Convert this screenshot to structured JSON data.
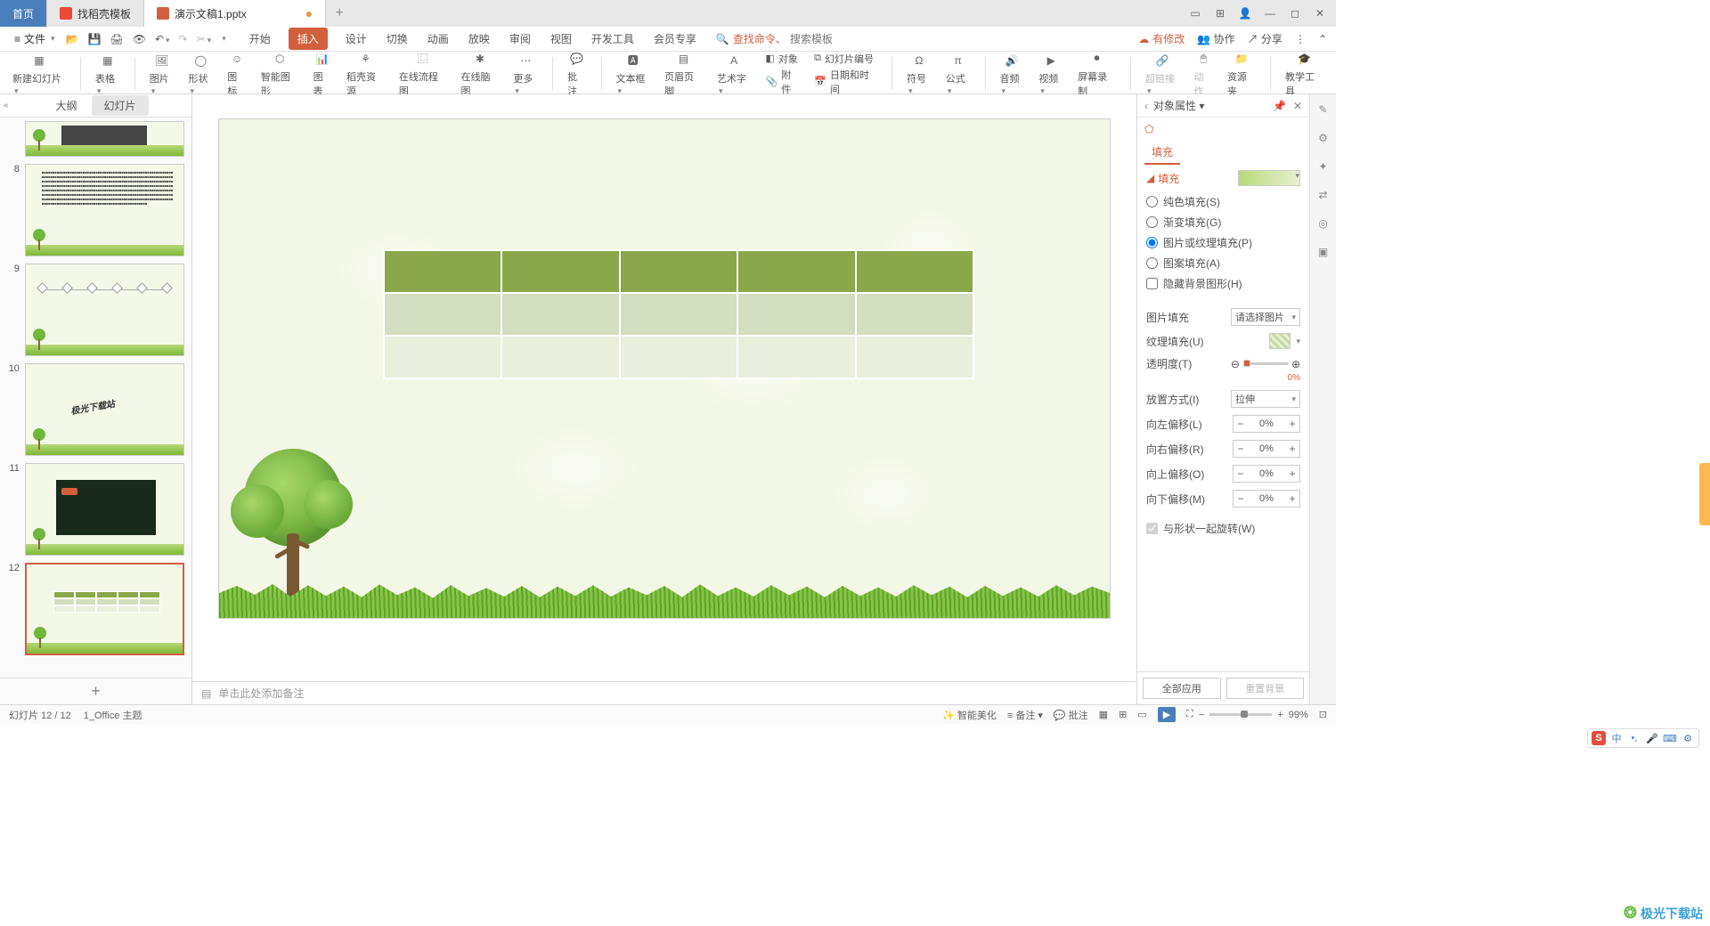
{
  "titlebar": {
    "home": "首页",
    "tab_template": "找稻壳模板",
    "tab_doc": "演示文稿1.pptx"
  },
  "menubar": {
    "file": "文件",
    "items": [
      "开始",
      "插入",
      "设计",
      "切换",
      "动画",
      "放映",
      "审阅",
      "视图",
      "开发工具",
      "会员专享"
    ],
    "active_index": 1,
    "search_prefix": "查找命令、",
    "search_placeholder": "搜索模板",
    "cloud_mod": "有修改",
    "collab": "协作",
    "share": "分享"
  },
  "ribbon": {
    "new_slide": "新建幻灯片",
    "table": "表格",
    "picture": "图片",
    "shape": "形状",
    "icon": "图标",
    "smart_shape": "智能图形",
    "chart": "图表",
    "docer": "稻壳资源",
    "flowchart": "在线流程图",
    "mindmap": "在线脑图",
    "more": "更多",
    "comment": "批注",
    "textbox": "文本框",
    "header_footer": "页眉页脚",
    "wordart": "艺术字",
    "object": "对象",
    "slide_num": "幻灯片编号",
    "attach": "附件",
    "datetime": "日期和时间",
    "symbol": "符号",
    "formula": "公式",
    "audio": "音频",
    "video": "视频",
    "record": "屏幕录制",
    "hyperlink": "超链接",
    "action": "动作",
    "resource": "资源夹",
    "teach": "教学工具"
  },
  "slidepanel": {
    "tab_outline": "大纲",
    "tab_slides": "幻灯片",
    "thumb10_text": "极光下载站"
  },
  "notes_placeholder": "单击此处添加备注",
  "prop": {
    "title": "对象属性",
    "fill_tab": "填充",
    "section_fill": "填充",
    "opt_solid": "纯色填充(S)",
    "opt_gradient": "渐变填充(G)",
    "opt_picture": "图片或纹理填充(P)",
    "opt_pattern": "图案填充(A)",
    "opt_hidebg": "隐藏背景图形(H)",
    "pic_fill": "图片填充",
    "pic_fill_val": "请选择图片",
    "tex_fill": "纹理填充(U)",
    "transparency": "透明度(T)",
    "transparency_val": "0%",
    "place": "放置方式(I)",
    "place_val": "拉伸",
    "off_left": "向左偏移(L)",
    "off_right": "向右偏移(R)",
    "off_top": "向上偏移(O)",
    "off_bottom": "向下偏移(M)",
    "off_val": "0%",
    "rotate": "与形状一起旋转(W)",
    "apply_all": "全部应用",
    "reset_bg": "重置背景"
  },
  "status": {
    "slide_count": "幻灯片 12 / 12",
    "theme": "1_Office 主题",
    "beautify": "智能美化",
    "notes": "备注",
    "comments": "批注",
    "zoom": "99%"
  },
  "watermark": "极光下载站"
}
